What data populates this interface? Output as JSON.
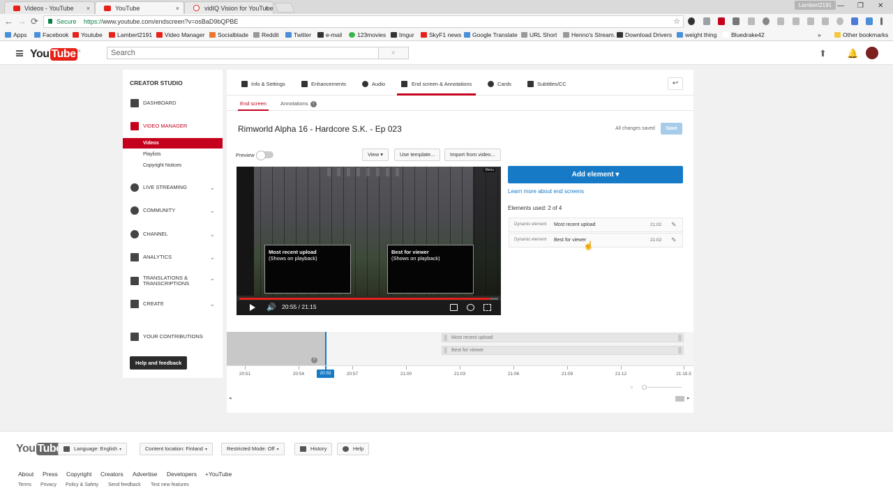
{
  "browser": {
    "tabs": [
      {
        "label": "Videos - YouTube",
        "close": "×"
      },
      {
        "label": "YouTube",
        "close": "×"
      },
      {
        "label": "vidIQ Vision for YouTube",
        "close": "×"
      }
    ],
    "profile": "Lambert2191",
    "window_controls": [
      "—",
      "❐",
      "✕"
    ],
    "nav": {
      "back": "←",
      "forward": "→",
      "reload": "⟳"
    },
    "secure_label": "Secure",
    "url_prefix": "https://",
    "url_rest": "www.youtube.com/endscreen?v=osBaD9bQPBE",
    "star": "☆",
    "bookmarks": [
      {
        "label": "Apps",
        "icon": "apps-icon"
      },
      {
        "label": "Facebook",
        "icon": "facebook-icon"
      },
      {
        "label": "Youtube",
        "icon": "youtube-icon"
      },
      {
        "label": "Lambert2191",
        "icon": "youtube-icon"
      },
      {
        "label": "Video Manager",
        "icon": "youtube-icon"
      },
      {
        "label": "Socialblade",
        "icon": "socialblade-icon"
      },
      {
        "label": "Reddit",
        "icon": "reddit-icon"
      },
      {
        "label": "Twitter",
        "icon": "twitter-icon"
      },
      {
        "label": "e-mail",
        "icon": "mail-icon"
      },
      {
        "label": "123movies",
        "icon": "movies-icon"
      },
      {
        "label": "Imgur",
        "icon": "imgur-icon"
      },
      {
        "label": "SkyF1 news",
        "icon": "news-icon"
      },
      {
        "label": "Google Translate",
        "icon": "translate-icon"
      },
      {
        "label": "URL Short",
        "icon": "google-icon"
      },
      {
        "label": "Henno's Stream.",
        "icon": "stream-icon"
      },
      {
        "label": "Download Drivers",
        "icon": "drivers-icon"
      },
      {
        "label": "weight thing",
        "icon": "weight-icon"
      },
      {
        "label": "Bluedrake42",
        "icon": "page-icon"
      }
    ],
    "bookmarks_more": "»",
    "other_bookmarks": "Other bookmarks"
  },
  "header": {
    "logo_you": "You",
    "logo_tube": "Tube",
    "logo_region": "FI",
    "search_placeholder": "Search",
    "search_icon": "⌕",
    "upload_icon": "⬆",
    "bell_icon": "🔔"
  },
  "sidebar": {
    "title": "CREATOR STUDIO",
    "items": [
      {
        "label": "DASHBOARD",
        "icon": "dashboard-icon"
      },
      {
        "label": "VIDEO MANAGER",
        "icon": "video-manager-icon"
      },
      {
        "label": "LIVE STREAMING",
        "icon": "live-icon"
      },
      {
        "label": "COMMUNITY",
        "icon": "community-icon"
      },
      {
        "label": "CHANNEL",
        "icon": "channel-icon"
      },
      {
        "label": "ANALYTICS",
        "icon": "analytics-icon"
      },
      {
        "label": "TRANSLATIONS &",
        "label2": "TRANSCRIPTIONS",
        "icon": "translate-icon"
      },
      {
        "label": "CREATE",
        "icon": "create-icon"
      },
      {
        "label": "YOUR CONTRIBUTIONS",
        "icon": "contributions-icon"
      }
    ],
    "sub_items": [
      "Videos",
      "Playlists",
      "Copyright Notices"
    ],
    "chevron": "⌄",
    "help": "Help and feedback"
  },
  "editor": {
    "tabs": [
      {
        "label": "Info & Settings",
        "icon": "pencil-icon"
      },
      {
        "label": "Enhancements",
        "icon": "magic-wand-icon"
      },
      {
        "label": "Audio",
        "icon": "music-note-icon"
      },
      {
        "label": "End screen & Annotations",
        "icon": "end-screen-icon"
      },
      {
        "label": "Cards",
        "icon": "info-icon"
      },
      {
        "label": "Subtitles/CC",
        "icon": "cc-icon"
      }
    ],
    "back": "↩",
    "sub_tabs": [
      "End screen",
      "Annotations"
    ],
    "info": "i",
    "video_title": "Rimworld Alpha 16 - Hardcore S.K. - Ep 023",
    "saved_status": "All changes saved",
    "save": "Save",
    "preview": "Preview",
    "view_btn": "View ▾",
    "template_btn": "Use template...",
    "import_btn": "Import from video..."
  },
  "player": {
    "badge": "Menu",
    "cards": [
      {
        "title": "Most recent upload",
        "sub": "(Shows on playback)"
      },
      {
        "title": "Best for viewer",
        "sub": "(Shows on playback)"
      }
    ],
    "time": "20:55 / 21:15",
    "progress": 0.97,
    "volume_icon": "🔊"
  },
  "elements_panel": {
    "add": "Add element ▾",
    "learn": "Learn more about end screens",
    "used": "Elements used: 2 of 4",
    "rows": [
      {
        "kind": "Dynamic element",
        "name": "Most recent upload",
        "time": "21:02",
        "edit": "✎"
      },
      {
        "kind": "Dynamic element",
        "name": "Best for viewer",
        "time": "21:02",
        "edit": "✎"
      }
    ]
  },
  "timeline": {
    "rows": [
      "Most recent upload",
      "Best for viewer"
    ],
    "help": "?",
    "ticks": [
      "20:51",
      "20:54",
      "20:57",
      "21:00",
      "21:03",
      "21:06",
      "21:09",
      "21:12",
      "21:15.5"
    ],
    "current": "20:55",
    "scroll_left": "◂",
    "scroll_right": "▸",
    "zoom_icon": "⌕"
  },
  "footer": {
    "logo_you": "You",
    "logo_tube": "Tube",
    "language": "Language: English",
    "location": "Content location: Finland",
    "restricted": "Restricted Mode: Off",
    "history": "History",
    "help": "Help",
    "dd": "▾",
    "links": [
      "About",
      "Press",
      "Copyright",
      "Creators",
      "Advertise",
      "Developers",
      "+YouTube"
    ],
    "links2": [
      "Terms",
      "Privacy",
      "Policy & Safety",
      "Send feedback",
      "Test new features"
    ]
  }
}
